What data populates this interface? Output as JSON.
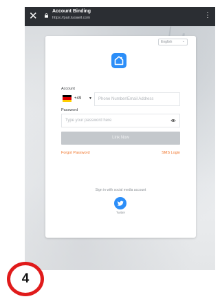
{
  "topbar": {
    "close_glyph": "✕",
    "title": "Account Binding",
    "url": "https://pair.tuoaeil.com",
    "menu_glyph": "⋮"
  },
  "card": {
    "language": "English",
    "account_label": "Account",
    "country_code": "+49",
    "phone_placeholder": "Phone Number/Email Address",
    "password_label": "Password",
    "password_placeholder": "Type your password here",
    "link_button": "Link Now",
    "forgot_password": "Forgot Password",
    "sms_login": "SMS Login",
    "sign_in_with": "Sign in with social media account",
    "twitter_label": "Twitter"
  },
  "step_marker": "4",
  "colors": {
    "accent": "#2c8ef8",
    "link_orange": "#f0742a",
    "button_disabled": "#c4c8cc",
    "topbar": "#2b2e33",
    "marker_red": "#e01b1b"
  },
  "icons": [
    "close-icon",
    "lock-icon",
    "more-vert-icon",
    "chevron-down-icon",
    "app-home-logo-icon",
    "germany-flag-icon",
    "eye-icon",
    "twitter-icon"
  ]
}
